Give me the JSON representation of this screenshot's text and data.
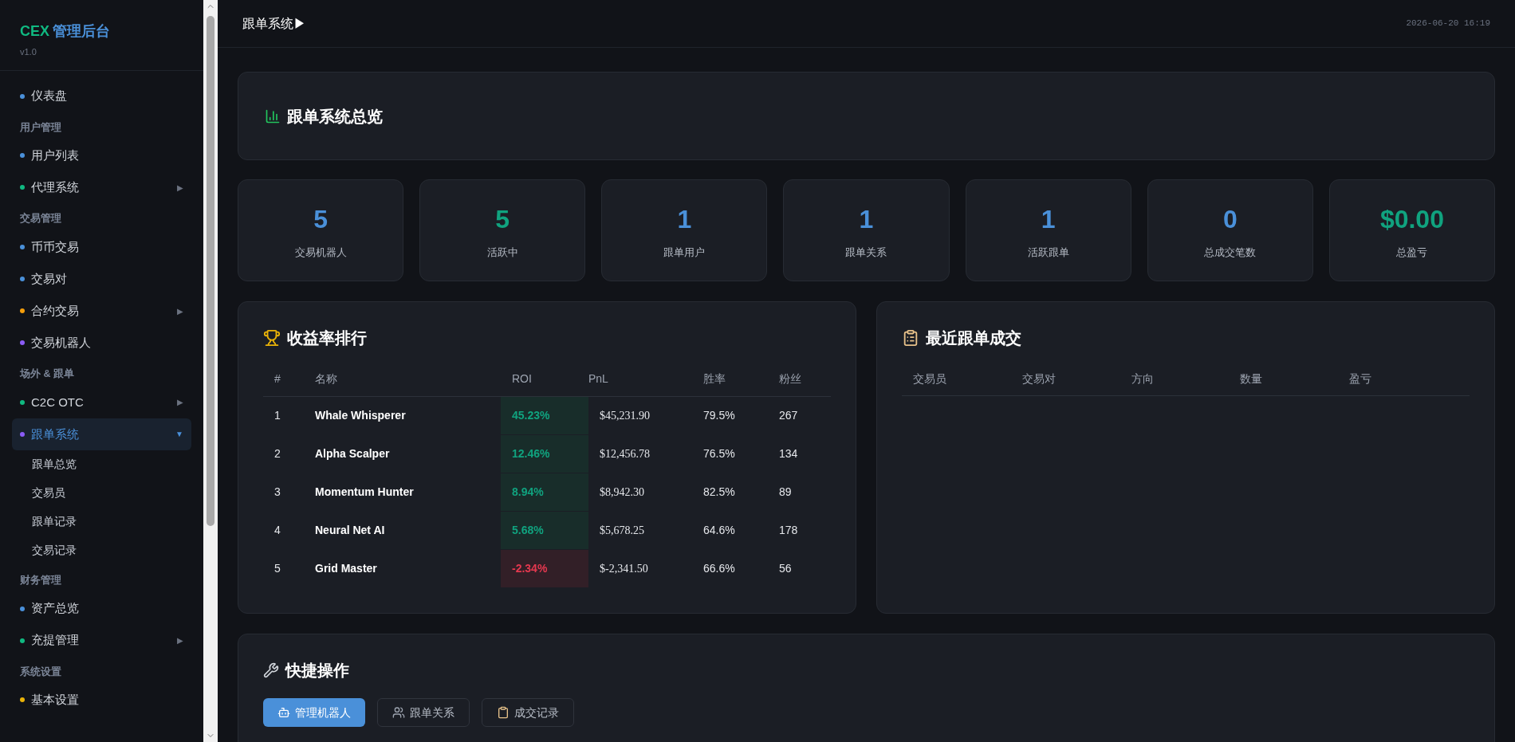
{
  "sidebar": {
    "brand": "CEX",
    "title": "管理后台",
    "version": "v1.0",
    "sections": [
      {
        "items": [
          {
            "label": "仪表盘",
            "color": "#4a90d9",
            "selected": false
          }
        ]
      },
      {
        "heading": "用户管理",
        "items": [
          {
            "label": "用户列表",
            "color": "#4a90d9",
            "selected": false
          },
          {
            "label": "代理系统",
            "color": "#10b981",
            "selected": false,
            "arrow": "▶"
          }
        ]
      },
      {
        "heading": "交易管理",
        "items": [
          {
            "label": "币币交易",
            "color": "#4a90d9",
            "selected": false
          },
          {
            "label": "交易对",
            "color": "#4a90d9",
            "selected": false
          },
          {
            "label": "合约交易",
            "color": "#f59e0b",
            "selected": false,
            "arrow": "▶"
          },
          {
            "label": "交易机器人",
            "color": "#8b5cf6",
            "selected": false
          }
        ]
      },
      {
        "heading": "场外 & 跟单",
        "items": [
          {
            "label": "C2C OTC",
            "color": "#10b981",
            "selected": false,
            "arrow": "▶"
          },
          {
            "label": "跟单系统",
            "color": "#8b5cf6",
            "selected": true,
            "arrow": "▼",
            "children": [
              "跟单总览",
              "交易员",
              "跟单记录",
              "交易记录"
            ]
          }
        ]
      },
      {
        "heading": "财务管理",
        "items": [
          {
            "label": "资产总览",
            "color": "#4a90d9",
            "selected": false
          },
          {
            "label": "充提管理",
            "color": "#10b981",
            "selected": false,
            "arrow": "▶"
          }
        ]
      },
      {
        "heading": "系统设置",
        "items": [
          {
            "label": "基本设置",
            "color": "#eab308",
            "selected": false
          }
        ]
      }
    ]
  },
  "header": {
    "title": "跟单系统▶",
    "time": "2026-06-20 16:19"
  },
  "overview": {
    "title": "跟单系统总览"
  },
  "stats": [
    {
      "value": "5",
      "label": "交易机器人",
      "color": "#4a90d9"
    },
    {
      "value": "5",
      "label": "活跃中",
      "color": "#10a37f"
    },
    {
      "value": "1",
      "label": "跟单用户",
      "color": "#4a90d9"
    },
    {
      "value": "1",
      "label": "跟单关系",
      "color": "#4a90d9"
    },
    {
      "value": "1",
      "label": "活跃跟单",
      "color": "#4a90d9"
    },
    {
      "value": "0",
      "label": "总成交笔数",
      "color": "#4a90d9"
    },
    {
      "value": "$0.00",
      "label": "总盈亏",
      "color": "#10a37f"
    }
  ],
  "ranking": {
    "title": "收益率排行",
    "columns": [
      "#",
      "名称",
      "ROI",
      "PnL",
      "胜率",
      "粉丝"
    ],
    "rows": [
      {
        "rank": "1",
        "name": "Whale Whisperer",
        "roi": "45.23%",
        "kind": "gain",
        "pnl": "$45,231.90",
        "win_rate": "79.5%",
        "followers": "267"
      },
      {
        "rank": "2",
        "name": "Alpha Scalper",
        "roi": "12.46%",
        "kind": "gain",
        "pnl": "$12,456.78",
        "win_rate": "76.5%",
        "followers": "134"
      },
      {
        "rank": "3",
        "name": "Momentum Hunter",
        "roi": "8.94%",
        "kind": "gain",
        "pnl": "$8,942.30",
        "win_rate": "82.5%",
        "followers": "89"
      },
      {
        "rank": "4",
        "name": "Neural Net AI",
        "roi": "5.68%",
        "kind": "gain",
        "pnl": "$5,678.25",
        "win_rate": "64.6%",
        "followers": "178"
      },
      {
        "rank": "5",
        "name": "Grid Master",
        "roi": "-2.34%",
        "kind": "loss",
        "pnl": "$-2,341.50",
        "win_rate": "66.6%",
        "followers": "56"
      }
    ]
  },
  "recent": {
    "title": "最近跟单成交",
    "columns": [
      "交易员",
      "交易对",
      "方向",
      "数量",
      "盈亏"
    ]
  },
  "quick": {
    "title": "快捷操作",
    "buttons": [
      {
        "label": "管理机器人",
        "kind": "robot",
        "selected": true
      },
      {
        "label": "跟单关系",
        "kind": "users",
        "selected": false
      },
      {
        "label": "成交记录",
        "kind": "clipboard",
        "selected": false
      }
    ]
  }
}
